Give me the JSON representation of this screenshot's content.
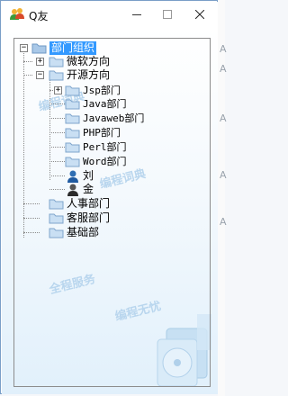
{
  "window": {
    "title": "Q友"
  },
  "titlebar": {
    "minimize_icon": "minimize-icon",
    "maximize_icon": "maximize-icon",
    "close_icon": "close-icon"
  },
  "watermarks": [
    "编程词典",
    "全程服务",
    "编程无忧",
    "编程词典"
  ],
  "tree": {
    "root": {
      "label": "部门组织",
      "expanded": true,
      "selected": true
    },
    "nodes": [
      {
        "label": "微软方向",
        "expander": "+"
      },
      {
        "label": "开源方向",
        "expander": "−"
      },
      {
        "label": "Jsp部门",
        "expander": "+"
      },
      {
        "label": "Java部门"
      },
      {
        "label": "Javaweb部门"
      },
      {
        "label": "PHP部门"
      },
      {
        "label": "Perl部门"
      },
      {
        "label": "Word部门"
      },
      {
        "label": "刘",
        "type": "user"
      },
      {
        "label": "金",
        "type": "user"
      },
      {
        "label": "人事部门"
      },
      {
        "label": "客服部门"
      },
      {
        "label": "基础部"
      }
    ]
  },
  "background_window": {
    "letters": [
      "A",
      "A",
      "A",
      "A",
      "A"
    ]
  },
  "colors": {
    "selection": "#3399ff",
    "folder": "#8fb8e0",
    "watermark": "#b9d6ee"
  }
}
